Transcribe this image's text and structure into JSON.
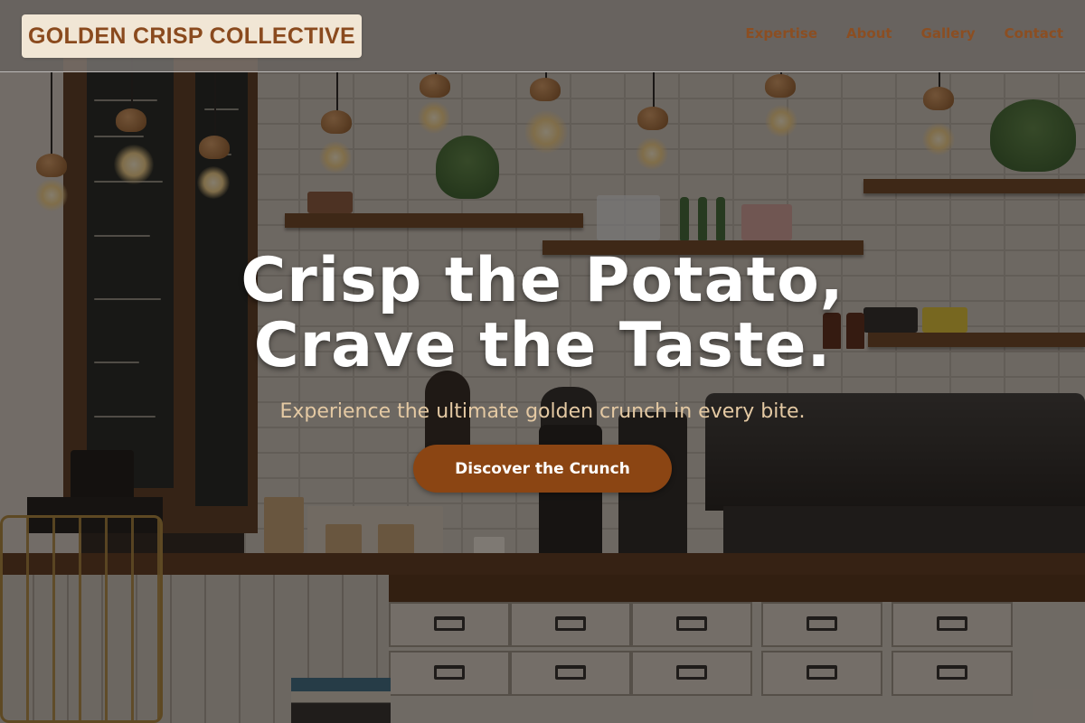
{
  "brand": {
    "name": "GOLDEN CRISP COLLECTIVE",
    "text_color": "#8a4a1e",
    "badge_color": "#f1e6d5"
  },
  "nav": {
    "items": [
      {
        "label": "Expertise"
      },
      {
        "label": "About"
      },
      {
        "label": "Gallery"
      },
      {
        "label": "Contact"
      }
    ],
    "link_color": "#8f4d1d"
  },
  "hero": {
    "title_line1": "Crisp the Potato,",
    "title_line2": "Crave the Taste.",
    "subtitle": "Experience the ultimate golden crunch in every bite.",
    "cta_label": "Discover the Crunch",
    "cta_color": "#8b4513",
    "subtitle_color": "#e4c9a3",
    "background": "café interior photo with hanging edison bulbs, chalkboard menu, shelves and espresso counter"
  }
}
